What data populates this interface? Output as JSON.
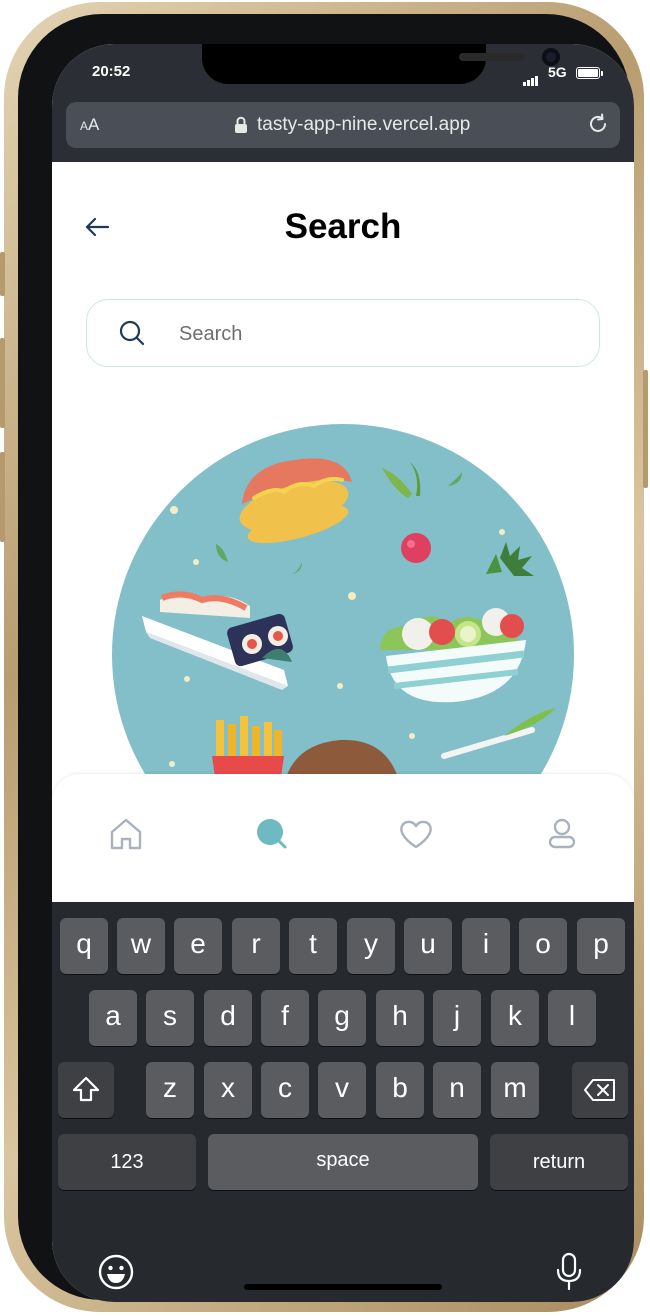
{
  "status_bar": {
    "time": "20:52",
    "network": "5G"
  },
  "browser": {
    "text_size_label_large": "A",
    "text_size_label_small": "A",
    "url": "tasty-app-nine.vercel.app",
    "icons": [
      "lock-icon",
      "reload-icon"
    ]
  },
  "page": {
    "title": "Search",
    "search": {
      "placeholder": "Search",
      "value": ""
    },
    "illustration": "food-illustration"
  },
  "bottom_nav": {
    "items": [
      "home-icon",
      "search-icon",
      "heart-icon",
      "profile-icon"
    ],
    "active": "search-icon",
    "accent": "#6fb9c0",
    "inactive": "#a9b2bd"
  },
  "keyboard": {
    "row1": [
      "q",
      "w",
      "e",
      "r",
      "t",
      "y",
      "u",
      "i",
      "o",
      "p"
    ],
    "row2": [
      "a",
      "s",
      "d",
      "f",
      "g",
      "h",
      "j",
      "k",
      "l"
    ],
    "row3": [
      "z",
      "x",
      "c",
      "v",
      "b",
      "n",
      "m"
    ],
    "numbers": "123",
    "space": "space",
    "return": "return",
    "icons": [
      "shift-icon",
      "backspace-icon",
      "emoji-icon",
      "microphone-icon"
    ]
  },
  "colors": {
    "illustration_bg": "#82bfc8",
    "keyboard_bg": "#26292d",
    "key": "#5a5c60",
    "key_dark": "#3e4044"
  }
}
